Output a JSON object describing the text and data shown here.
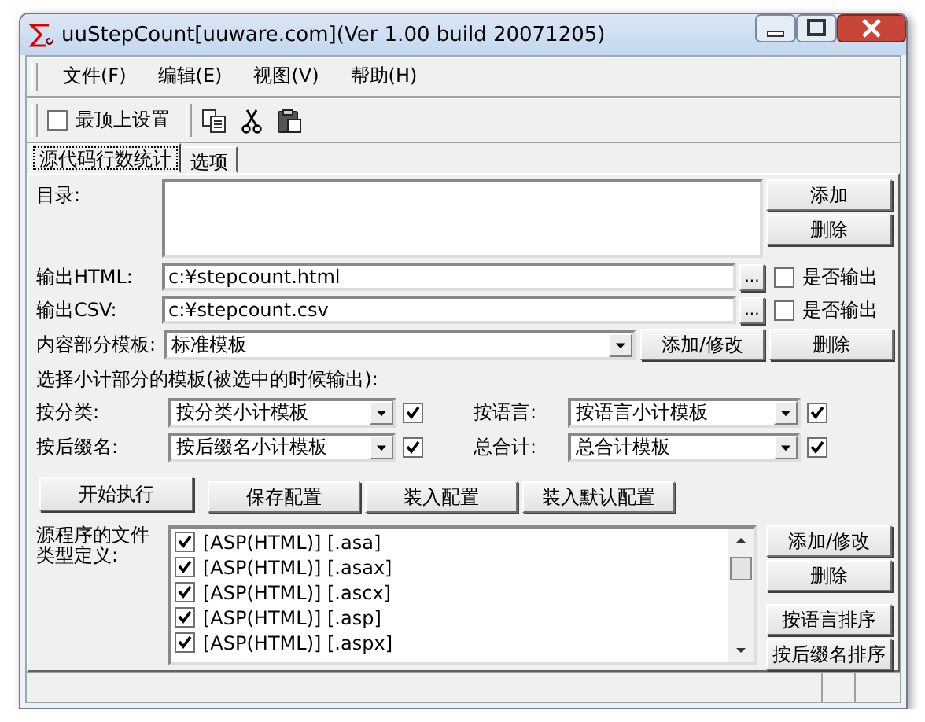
{
  "window": {
    "title": "uuStepCount[uuware.com](Ver 1.00 build 20071205)"
  },
  "menu": [
    {
      "label": "文件(F)"
    },
    {
      "label": "编辑(E)"
    },
    {
      "label": "视图(V)"
    },
    {
      "label": "帮助(H)"
    }
  ],
  "toolbar": {
    "topmost": {
      "label": "最顶上设置",
      "checked": false
    }
  },
  "tabs": [
    {
      "label": "源代码行数统计",
      "selected": true
    },
    {
      "label": "选项",
      "selected": false
    }
  ],
  "directory": {
    "label": "目录:",
    "buttons": [
      "添加",
      "删除"
    ]
  },
  "outputs": [
    {
      "label": "输出HTML:",
      "value": "c:¥stepcount.html",
      "browse": "...",
      "option": {
        "label": "是否输出",
        "checked": false
      }
    },
    {
      "label": "输出CSV:",
      "value": "c:¥stepcount.csv",
      "browse": "...",
      "option": {
        "label": "是否输出",
        "checked": false
      }
    }
  ],
  "content_template": {
    "label": "内容部分模板:",
    "value": "标准模板",
    "buttons": [
      "添加/修改",
      "删除"
    ]
  },
  "subtotal": {
    "heading": "选择小计部分的模板(被选中的时候输出):",
    "items": [
      {
        "label": "按分类:",
        "value": "按分类小计模板",
        "checked": true
      },
      {
        "label": "按语言:",
        "value": "按语言小计模板",
        "checked": true
      },
      {
        "label": "按后缀名:",
        "value": "按后缀名小计模板",
        "checked": true
      },
      {
        "label": "总合计:",
        "value": "总合计模板",
        "checked": true
      }
    ]
  },
  "actions": [
    "开始执行",
    "保存配置",
    "装入配置",
    "装入默认配置"
  ],
  "file_types": {
    "label": "源程序的文件类型定义:",
    "items": [
      {
        "label": "[ASP(HTML)] [.asa]",
        "checked": true
      },
      {
        "label": "[ASP(HTML)] [.asax]",
        "checked": true
      },
      {
        "label": "[ASP(HTML)] [.ascx]",
        "checked": true
      },
      {
        "label": "[ASP(HTML)] [.asp]",
        "checked": true
      },
      {
        "label": "[ASP(HTML)] [.aspx]",
        "checked": true
      }
    ],
    "buttons": [
      "添加/修改",
      "删除",
      "按语言排序",
      "按后缀名排序"
    ]
  }
}
